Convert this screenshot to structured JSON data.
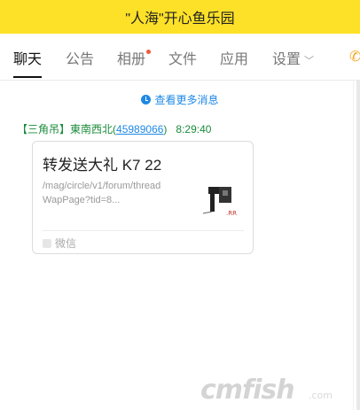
{
  "window": {
    "title": "\"人海\"开心鱼乐园"
  },
  "tabs": [
    {
      "label": "聊天"
    },
    {
      "label": "公告"
    },
    {
      "label": "相册"
    },
    {
      "label": "文件"
    },
    {
      "label": "应用"
    },
    {
      "label": "设置"
    }
  ],
  "chat": {
    "more_messages": "查看更多消息",
    "sender_tag": "【三角吊】",
    "sender_name": "東南西北",
    "sender_qq_open": "(",
    "sender_qq": "45989066",
    "sender_qq_close": ")",
    "time": "8:29:40",
    "card": {
      "title": "转发送大礼 K7 22",
      "url": "/mag/circle/v1/forum/threadWapPage?tid=8...",
      "thumb_text": ".RR",
      "source": "微信"
    }
  },
  "watermark": {
    "text": "cmfish",
    "suffix": ".com"
  },
  "colors": {
    "titlebar": "#fde128",
    "link": "#1e88e5",
    "sender": "#1a8b3a",
    "badge": "#f05a3a"
  }
}
